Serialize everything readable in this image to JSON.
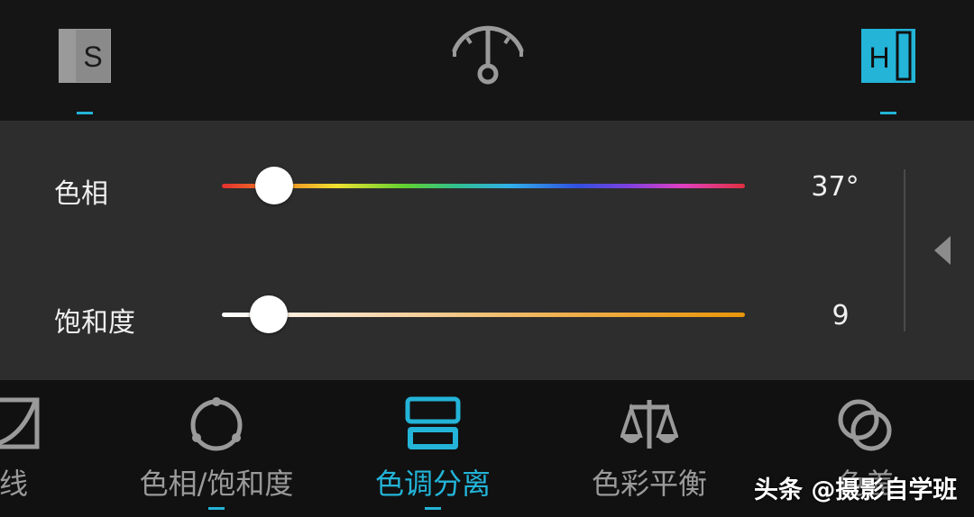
{
  "topbar": {
    "left_icon": "shadows-s-icon",
    "center_icon": "balance-dial-icon",
    "right_icon": "highlights-h-icon",
    "s_letter": "S",
    "h_letter": "H"
  },
  "panel": {
    "hue": {
      "label": "色相",
      "value": "37°",
      "fraction": 0.1
    },
    "saturation": {
      "label": "饱和度",
      "value": "9",
      "fraction": 0.09
    },
    "collapse_icon": "chevron-left-icon"
  },
  "tabs": [
    {
      "label": "线",
      "icon": "curve-icon",
      "active": false
    },
    {
      "label": "色相/饱和度",
      "icon": "hue-ring-icon",
      "active": false
    },
    {
      "label": "色调分离",
      "icon": "split-tone-icon",
      "active": true
    },
    {
      "label": "色彩平衡",
      "icon": "balance-scale-icon",
      "active": false
    },
    {
      "label": "色差",
      "icon": "overlap-circles-icon",
      "active": false
    }
  ],
  "watermark": "头条 @摄影自学班",
  "colors": {
    "accent": "#23b4d8",
    "panel": "#2d2d2d",
    "background": "#121212"
  }
}
